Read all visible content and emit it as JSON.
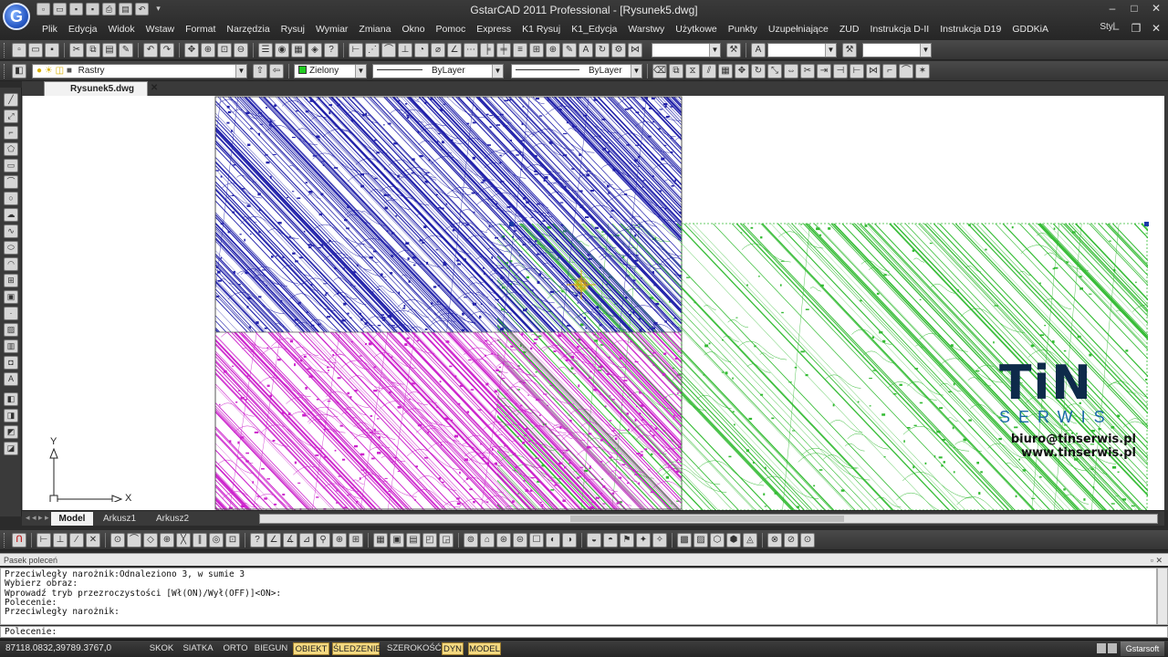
{
  "app": {
    "window_title": "GstarCAD 2011 Professional - [Rysunek5.dwg]",
    "logo_glyph": "G",
    "style_label": "Styl"
  },
  "menu": [
    "Plik",
    "Edycja",
    "Widok",
    "Wstaw",
    "Format",
    "Narzędzia",
    "Rysuj",
    "Wymiar",
    "Zmiana",
    "Okno",
    "Pomoc",
    "Express",
    "K1 Rysuj",
    "K1_Edycja",
    "Warstwy",
    "Użytkowe",
    "Punkty",
    "Uzupełniające",
    "ZUD",
    "Instrukcja D-II",
    "Instrukcja D19",
    "GDDKiA"
  ],
  "layer_toolbar": {
    "layer_value": "Rastry",
    "color_value": "Zielony",
    "linetype_value": "ByLayer",
    "lineweight_value": "ByLayer"
  },
  "document_tab": "Rysunek5.dwg",
  "layout_tabs": [
    "Model",
    "Arkusz1",
    "Arkusz2"
  ],
  "ucs": {
    "x_label": "X",
    "y_label": "Y"
  },
  "watermark": {
    "brand": "TiN",
    "sub": "SERWIS",
    "email": "biuro@tinserwis.pl",
    "web": "www.tinserwis.pl"
  },
  "command_panel": {
    "header": "Pasek poleceń",
    "history": [
      "Przeciwległy narożnik:Odnaleziono 3, w sumie 3",
      "Wybierz obraz:",
      "Wprowadź tryb przezroczystości [Wł(ON)/Wył(OFF)]<ON>:",
      "Polecenie:",
      "Przeciwległy narożnik:"
    ],
    "prompt": "Polecenie:",
    "input_value": ""
  },
  "status": {
    "coordinates": "87118.0832,39789.3767,0",
    "buttons": [
      {
        "label": "SKOK",
        "on": false
      },
      {
        "label": "SIATKA",
        "on": false
      },
      {
        "label": "ORTO",
        "on": false
      },
      {
        "label": "BIEGUN",
        "on": false
      },
      {
        "label": "OBIEKT",
        "on": true
      },
      {
        "label": "ŚLEDZENIE",
        "on": true
      },
      {
        "label": "SZEROKOŚĆ",
        "on": false
      },
      {
        "label": "DYN",
        "on": true
      },
      {
        "label": "MODEL",
        "on": true
      }
    ],
    "brand_badge": "Gstarsoft"
  },
  "colors": {
    "raster_blue": "#2222aa",
    "raster_magenta": "#cc22cc",
    "raster_green": "#33bb33",
    "status_on": "#f5d980"
  }
}
